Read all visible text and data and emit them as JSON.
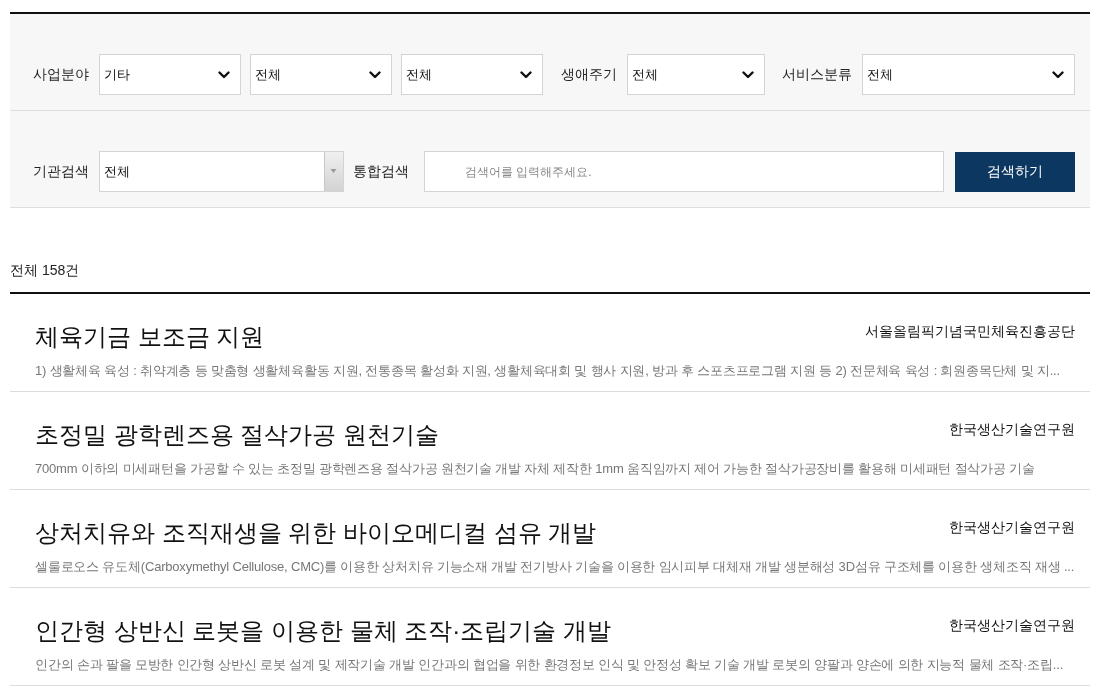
{
  "filter_panel": {
    "row_1": [
      {
        "label": "사업분야",
        "selects": [
          {
            "kind": "dropdown",
            "value": "기타"
          },
          {
            "kind": "dropdown",
            "value": "전체"
          },
          {
            "kind": "dropdown",
            "value": "전체"
          }
        ]
      },
      {
        "label": "생애주기",
        "selects": [
          {
            "kind": "dropdown",
            "value": "전체"
          }
        ]
      },
      {
        "label": "서비스분류",
        "selects": [
          {
            "kind": "dropdown",
            "value": "전체"
          }
        ]
      }
    ],
    "row_2": {
      "institution": {
        "label": "기관검색",
        "select": {
          "kind": "combo",
          "value": "전체"
        }
      },
      "search": {
        "label": "통합검색",
        "placeholder": "검색어를 입력해주세요.",
        "button": "검색하기"
      }
    }
  },
  "result_count": "전체 158건",
  "results": [
    {
      "title": "체육기금 보조금 지원",
      "organization": "서울올림픽기념국민체육진흥공단",
      "description": "1) 생활체육 육성 : 취약계층 등 맞춤형 생활체육활동 지원, 전통종목 활성화 지원, 생활체육대회 및 행사 지원, 방과 후 스포츠프로그램 지원 등 2) 전문체육 육성 : 회원종목단체 및 지..."
    },
    {
      "title": "초정밀 광학렌즈용 절삭가공 원천기술",
      "organization": "한국생산기술연구원",
      "description": "700mm 이하의 미세패턴을 가공할 수 있는 초정밀 광학렌즈용 절삭가공 원천기술 개발 자체 제작한 1mm 움직임까지 제어 가능한 절삭가공장비를 활용해 미세패턴 절삭가공 기술"
    },
    {
      "title": "상처치유와 조직재생을 위한 바이오메디컬 섬유 개발",
      "organization": "한국생산기술연구원",
      "description": "셀룰로오스 유도체(Carboxymethyl Cellulose, CMC)를 이용한 상처치유 기능소재 개발 전기방사 기술을 이용한 임시피부 대체재 개발 생분해성 3D섬유 구조체를 이용한 생체조직 재생 ..."
    },
    {
      "title": "인간형 상반신 로봇을 이용한 물체 조작·조립기술 개발",
      "organization": "한국생산기술연구원",
      "description": "인간의 손과 팔을 모방한 인간형 상반신 로봇 설계 및 제작기술 개발 인간과의 협업을 위한 환경정보 인식 및 안정성 확보 기술 개발 로봇의 양팔과 양손에 의한 지능적 물체 조작·조립..."
    }
  ]
}
